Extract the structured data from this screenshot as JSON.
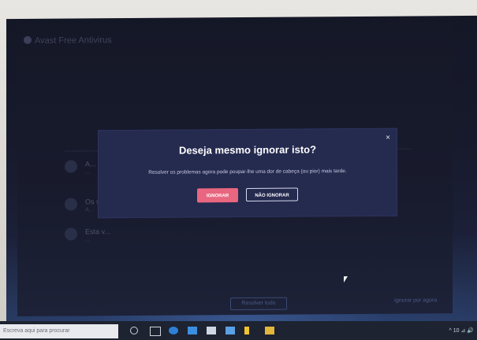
{
  "app": {
    "title": "Avast Free Antivirus"
  },
  "background": {
    "items": [
      {
        "title": "A...",
        "subtitle": "..."
      },
      {
        "title": "Os ser...",
        "subtitle": "A..."
      },
      {
        "title": "Esta v...",
        "subtitle": "..."
      }
    ],
    "bottom_button": "Resolver tudo",
    "bottom_link": "Ignorar por agora"
  },
  "modal": {
    "title": "Deseja mesmo ignorar isto?",
    "message": "Resolver os problemas agora pode poupar-lhe uma dor de cabeça (ou pior) mais tarde.",
    "close_glyph": "×",
    "ignore_label": "IGNORAR",
    "dont_ignore_label": "NÃO IGNORAR"
  },
  "taskbar": {
    "search_placeholder": "Escreva aqui para procurar",
    "tray_text": "^ 10 ⊿ 🔊"
  },
  "colors": {
    "modal_bg": "#252a4f",
    "ignore_button": "#e8667f",
    "screen_bg": "#151827"
  }
}
